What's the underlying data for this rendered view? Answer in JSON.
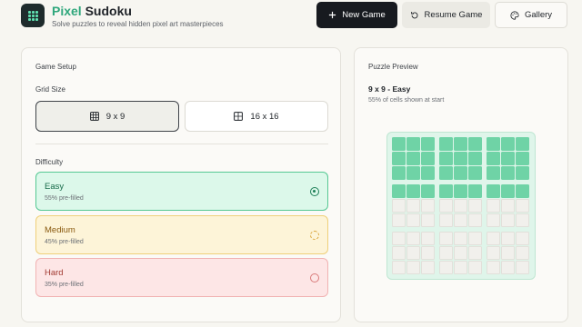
{
  "header": {
    "title_accent": "Pixel",
    "title_rest": "Sudoku",
    "subtitle": "Solve puzzles to reveal hidden pixel art masterpieces",
    "buttons": {
      "new_game": "New Game",
      "resume_game": "Resume Game",
      "gallery": "Gallery"
    },
    "icons": {
      "logo": "grid-dots-logo",
      "new_game": "plus-icon",
      "resume_game": "rotate-ccw-icon",
      "gallery": "palette-icon"
    }
  },
  "setup": {
    "section_title": "Game Setup",
    "grid_size_label": "Grid Size",
    "grid_sizes": [
      {
        "label": "9 x 9",
        "selected": true
      },
      {
        "label": "16 x 16",
        "selected": false
      }
    ],
    "difficulty_label": "Difficulty",
    "difficulties": [
      {
        "label": "Easy",
        "detail": "55% pre-filled",
        "selected": true,
        "color": "#56c893"
      },
      {
        "label": "Medium",
        "detail": "45% pre-filled",
        "selected": false,
        "color": "#efd07a"
      },
      {
        "label": "Hard",
        "detail": "35% pre-filled",
        "selected": false,
        "color": "#f1b3b3"
      }
    ]
  },
  "preview": {
    "section_title": "Puzzle Preview",
    "title": "9 x 9 - Easy",
    "subtitle": "55% of cells shown at start",
    "grid_size": 9,
    "filled_rows": 4,
    "fill_color": "#6fd3a6"
  }
}
